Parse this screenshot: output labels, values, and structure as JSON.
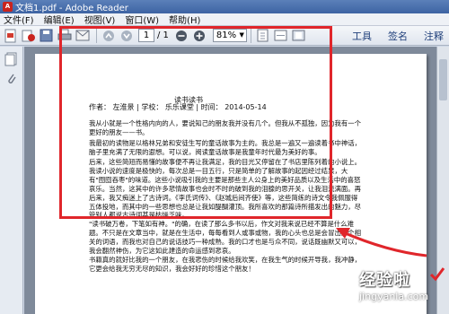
{
  "window": {
    "title": "文档1.pdf - Adobe Reader"
  },
  "menu": [
    "文件(F)",
    "编辑(E)",
    "视图(V)",
    "窗口(W)",
    "帮助(H)"
  ],
  "toolbar": {
    "page_current": "1",
    "page_total": "/ 1",
    "zoom": "81%",
    "buttons": {
      "tools": "工具",
      "sign": "签名",
      "comment": "注释"
    }
  },
  "document": {
    "title": "读书读书",
    "meta": "作者： 左淮景 | 学校： 乐乐课堂 | 时间： 2014-05-14",
    "paragraphs": [
      "我从小就是一个性格内向的人，要说知己的朋友我并没有几个。但我从不孤独，因为我有一个更好的朋友——书。",
      "我最初的读物是以格林兄弟和安徒生写的童话故事为主的。我总是一遍又一遍读着书中神话，脑子里充满了无限的遐想。可以说，阅读童话故事是我童年时代最为美好的事。",
      "后来，这些简短而易懂的故事便不再让我满足，我的目光又停留在了书店里陈列着的小说上。我读小说的速度是极快的，每次总是一目五行，只是简单的了解故事的起因经过结果，大有\"囫囵吞枣\"的味道。这些小说吸引我的主要是那些主人公身上的美好品质以及生活中的喜怒哀乐。当然，这其中的许多悲情故事也会时不时的破到我的泪腺的思开关，让我泪流满面。再后来，我又痴迷上了古诗词。《李氏词传》、《赵城后间齐使》等，这些简练的诗文令我佩服得五体投地，而其中的一些思想也总是让我如醍醐灌顶。我所喜欢的那篇诗所描发出的魅力，尽管别人都说古诗词甚是枯燥乏味。",
      "\"读书破万卷，下笔如有神。\"的确，在读了那么多书以后，作文对我来说已经不算是什么难题。不只是在文章当中，就是在生活中，每每看到人或事或物，我的心头也总是会冒出几个相关的词语，而我也对自己的说话技巧一种成熟。我的口才也是与众不同，说话既幽默又可以，我会翻然神伤，为它这如此建造的命运感到悲哀。",
      "书籍真的就好比我的一个朋友，在我悲伤的时候给我欢笑，在我生气的时候开导我，我冲静，它更会给我无穷无尽的知识，我会好好的珍惜这个朋友！"
    ]
  },
  "watermark": {
    "text": "经验啦",
    "url": "jingyanla.com"
  },
  "colors": {
    "highlight_box": "#e0262b",
    "title_bar": "#3d63a3",
    "viewer_bg": "#7f8a9a"
  }
}
